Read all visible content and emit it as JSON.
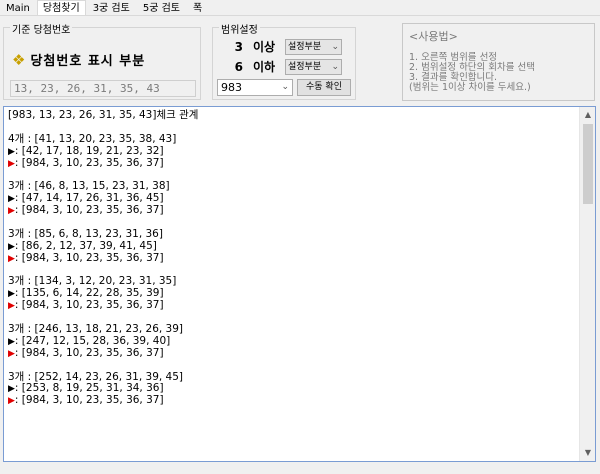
{
  "tabs": [
    "Main",
    "당첨찾기",
    "3궁 검토",
    "5궁 검토",
    "폭"
  ],
  "base_group": {
    "legend": "기준 당첨번호",
    "title": "당첨번호 표시 부분",
    "numbers": "13, 23, 26, 31, 35, 43"
  },
  "range_group": {
    "legend": "범위설정",
    "row1": {
      "num": "3",
      "op": "이상",
      "select": "설정부분"
    },
    "row2": {
      "num": "6",
      "op": "이하",
      "select": "설정부분"
    },
    "round": "983",
    "confirm_label": "수동 확인"
  },
  "usage": {
    "header": "<사용법>",
    "lines": [
      "1. 오른쪽 범위를 선정",
      "2. 범위설정 하단의 회차를 선택",
      "3. 결과를 확인합니다.",
      "(범위는 1이상 차이를 두세요.)"
    ]
  },
  "results": [
    {
      "type": "text",
      "text": "[983, 13, 23, 26, 31, 35, 43]체크 관계"
    },
    {
      "type": "blank"
    },
    {
      "type": "text",
      "text": "4개 : [41, 13, 20, 23, 35, 38, 43]"
    },
    {
      "type": "black",
      "text": ": [42, 17, 18, 19, 21, 23, 32]"
    },
    {
      "type": "red",
      "text": ": [984, 3, 10, 23, 35, 36, 37]"
    },
    {
      "type": "blank"
    },
    {
      "type": "text",
      "text": "3개 : [46, 8, 13, 15, 23, 31, 38]"
    },
    {
      "type": "black",
      "text": ": [47, 14, 17, 26, 31, 36, 45]"
    },
    {
      "type": "red",
      "text": ": [984, 3, 10, 23, 35, 36, 37]"
    },
    {
      "type": "blank"
    },
    {
      "type": "text",
      "text": "3개 : [85, 6, 8, 13, 23, 31, 36]"
    },
    {
      "type": "black",
      "text": ": [86, 2, 12, 37, 39, 41, 45]"
    },
    {
      "type": "red",
      "text": ": [984, 3, 10, 23, 35, 36, 37]"
    },
    {
      "type": "blank"
    },
    {
      "type": "text",
      "text": "3개 : [134, 3, 12, 20, 23, 31, 35]"
    },
    {
      "type": "black",
      "text": ": [135, 6, 14, 22, 28, 35, 39]"
    },
    {
      "type": "red",
      "text": ": [984, 3, 10, 23, 35, 36, 37]"
    },
    {
      "type": "blank"
    },
    {
      "type": "text",
      "text": "3개 : [246, 13, 18, 21, 23, 26, 39]"
    },
    {
      "type": "black",
      "text": ": [247, 12, 15, 28, 36, 39, 40]"
    },
    {
      "type": "red",
      "text": ": [984, 3, 10, 23, 35, 36, 37]"
    },
    {
      "type": "blank"
    },
    {
      "type": "text",
      "text": "3개 : [252, 14, 23, 26, 31, 39, 45]"
    },
    {
      "type": "black",
      "text": ": [253, 8, 19, 25, 31, 34, 36]"
    },
    {
      "type": "red",
      "text": ": [984, 3, 10, 23, 35, 36, 37]"
    }
  ],
  "colors": {
    "red_marker": "#e00000",
    "black_marker": "#000000",
    "focus_border": "#7a9cd3"
  },
  "icons": {
    "title": "diamond-bullet-icon",
    "marker": "triangle-right-icon"
  }
}
